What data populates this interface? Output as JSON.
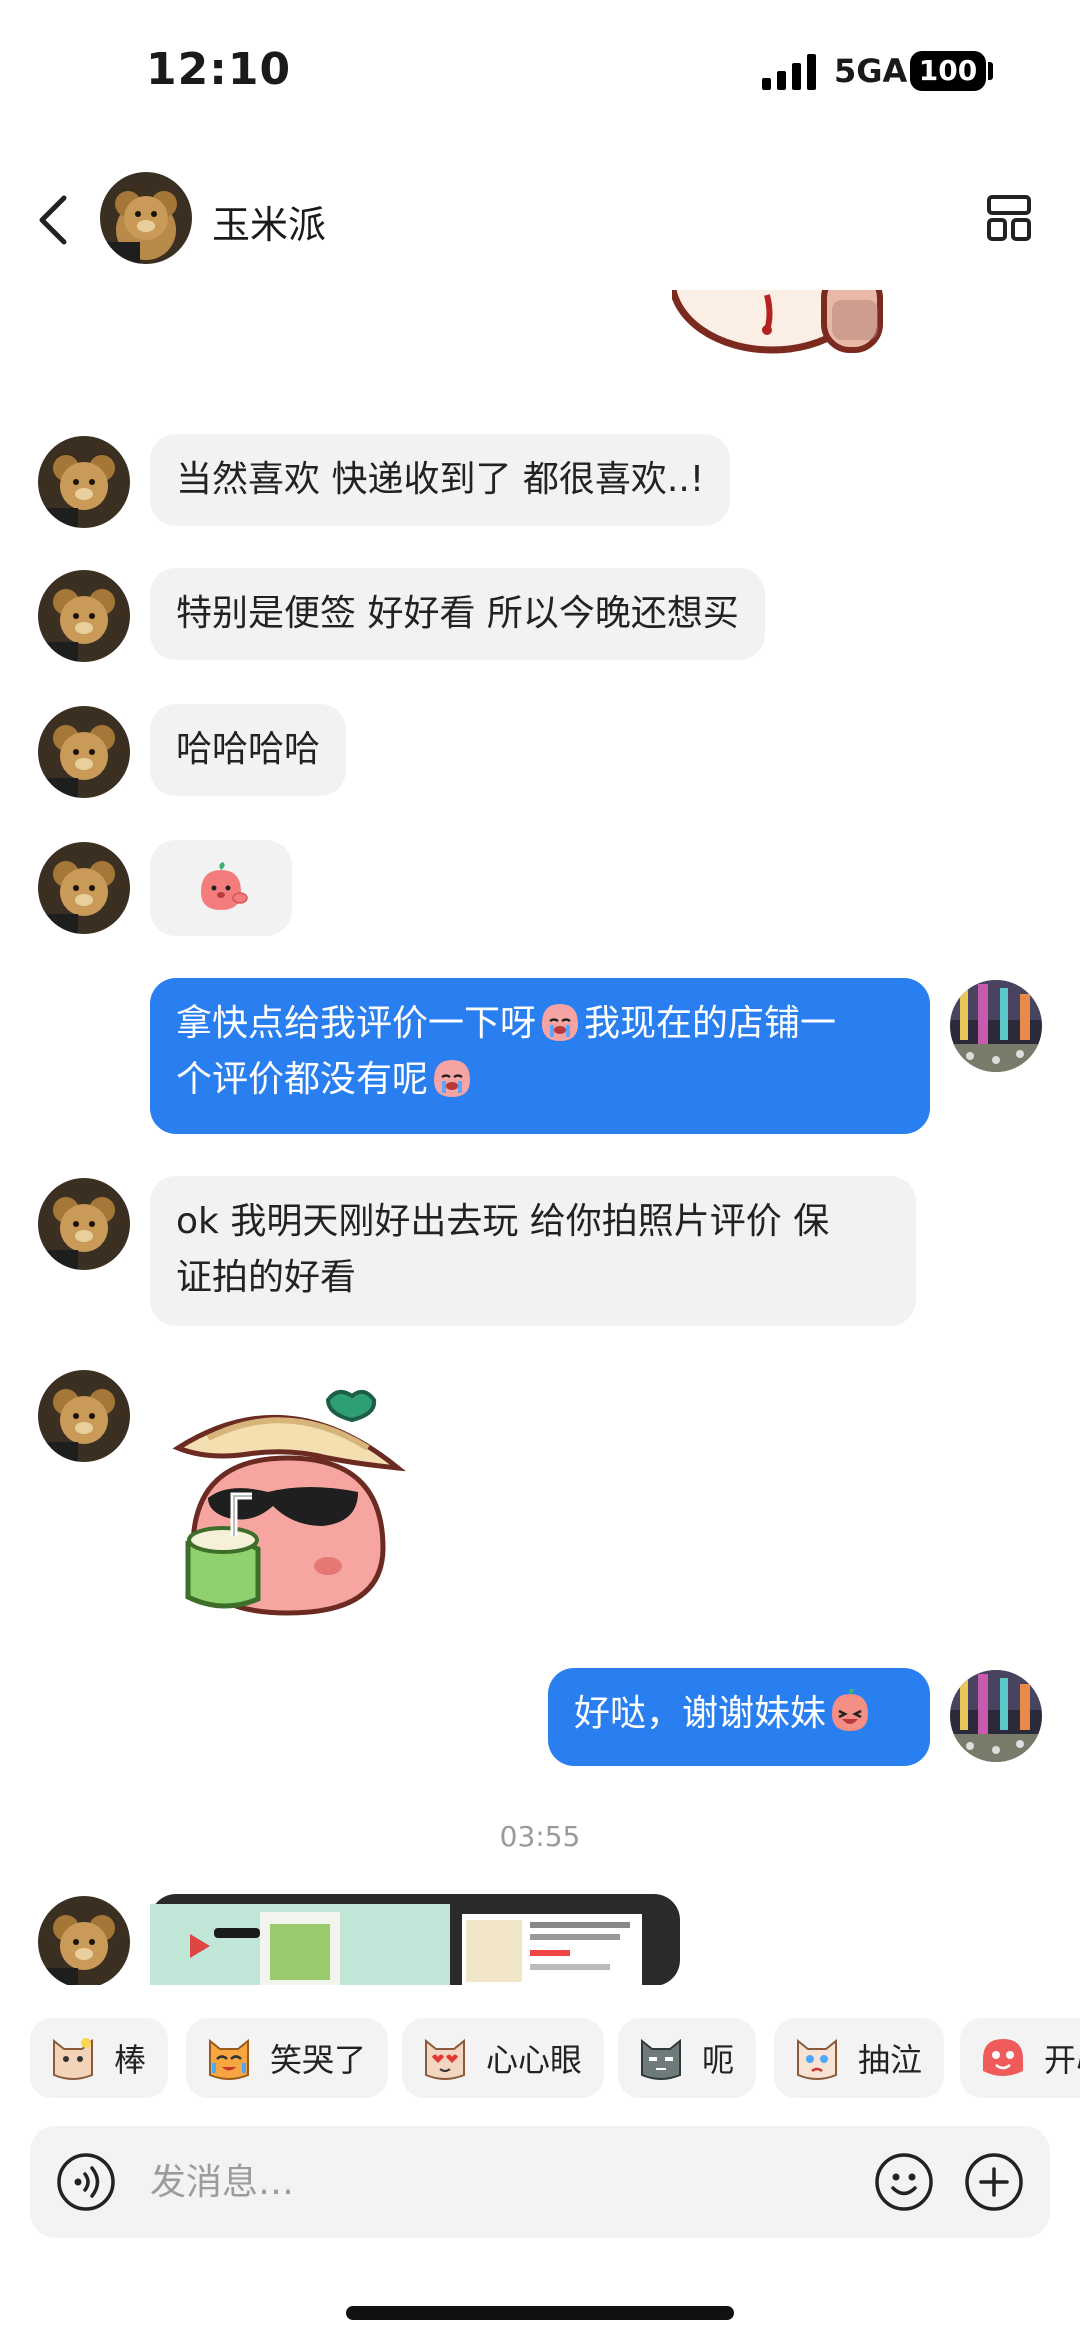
{
  "status_bar": {
    "time": "12:10",
    "network": "5GA",
    "battery": "100"
  },
  "header": {
    "contact_name": "玉米派",
    "back_icon": "chevron-left-icon",
    "more_icon": "layout-grid-icon"
  },
  "messages": [
    {
      "side": "in",
      "type": "sticker",
      "text": ""
    },
    {
      "side": "in",
      "type": "text",
      "text": "当然喜欢 快递收到了 都很喜欢..!"
    },
    {
      "side": "in",
      "type": "text",
      "text": "特别是便签 好好看 所以今晚还想买"
    },
    {
      "side": "in",
      "type": "text",
      "text": "哈哈哈哈"
    },
    {
      "side": "in",
      "type": "emoji",
      "text": ""
    },
    {
      "side": "out",
      "type": "text",
      "line1": "拿快点给我评价一下呀",
      "line1b": "我现在的店铺一",
      "line2": "个评价都没有呢"
    },
    {
      "side": "in",
      "type": "text",
      "line1": "ok 我明天刚好出去玩 给你拍照片评价 保",
      "line2": "证拍的好看"
    },
    {
      "side": "in",
      "type": "sticker",
      "text": ""
    },
    {
      "side": "out",
      "type": "text",
      "text": "好哒，谢谢妹妹"
    },
    {
      "side": "in",
      "type": "image",
      "text": ""
    }
  ],
  "time_separator": "03:55",
  "quick_reactions": [
    "棒",
    "笑哭了",
    "心心眼",
    "呃",
    "抽泣",
    "开心"
  ],
  "input": {
    "placeholder": "发消息…"
  },
  "colors": {
    "accent_blue": "#2a7ff0",
    "bubble_gray": "#f2f2f3",
    "background": "#ffffff"
  }
}
